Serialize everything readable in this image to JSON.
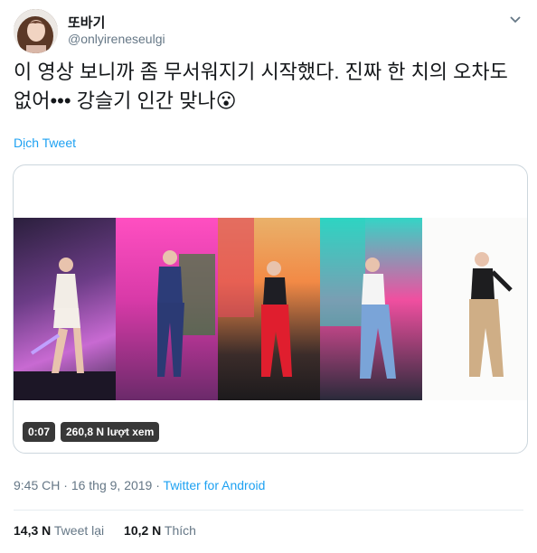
{
  "tweet": {
    "display_name": "또바기",
    "handle": "@onlyireneseulgi",
    "text": "이 영상 보니까 좀 무서워지기 시작했다. 진짜 한 치의 오차도 없어••• 강슬기 인간 맞나😮",
    "translate_label": "Dịch Tweet",
    "time": "9:45 CH",
    "separator": "·",
    "date": "16 thg 9, 2019",
    "source": "Twitter for Android"
  },
  "video": {
    "duration": "0:07",
    "views": "260,8 N lượt xem"
  },
  "stats": {
    "retweets_count": "14,3 N",
    "retweets_label": "Tweet lại",
    "likes_count": "10,2 N",
    "likes_label": "Thích"
  }
}
